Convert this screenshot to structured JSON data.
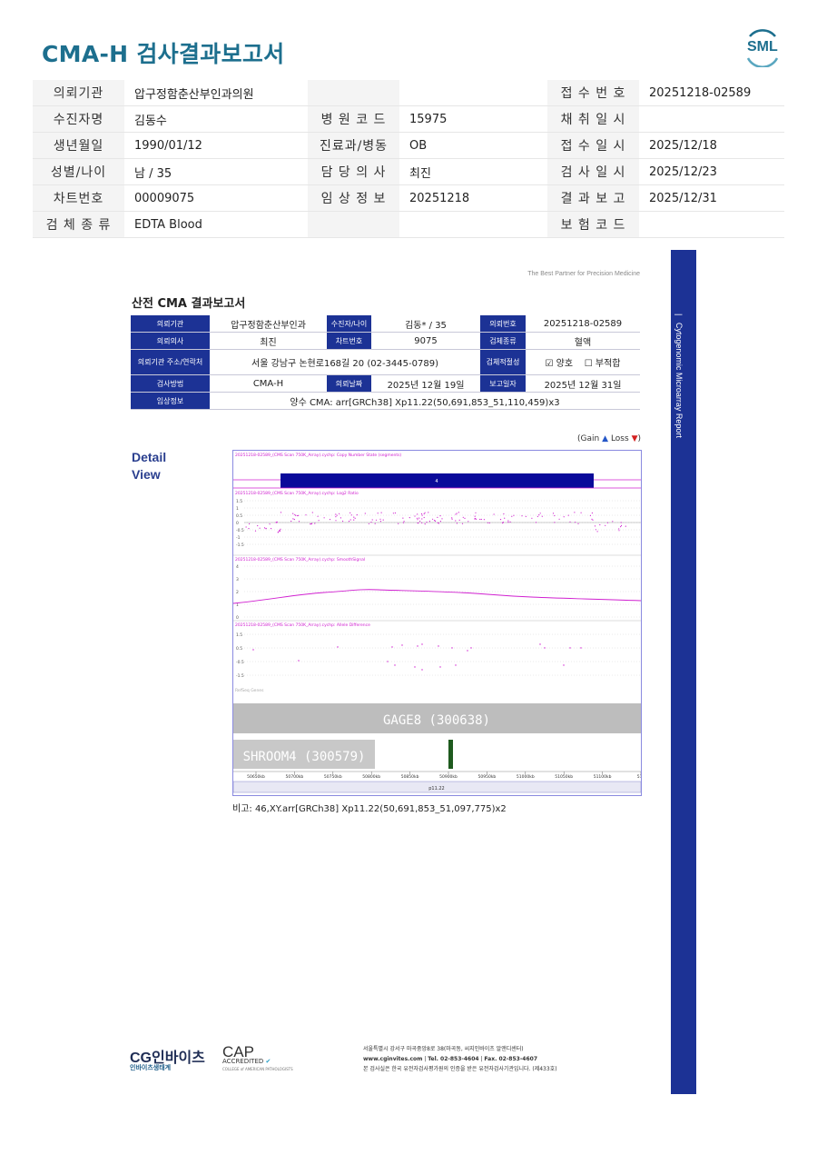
{
  "header": {
    "title": "CMA-H 검사결과보고서",
    "logo_text": "SML"
  },
  "info_rows": [
    {
      "l1": "의뢰기관",
      "v1": "압구정함춘산부인과의원",
      "l2": "",
      "v2": "",
      "l3": "접 수 번 호",
      "v3": "20251218-02589"
    },
    {
      "l1": "수진자명",
      "v1": "김동수",
      "l2": "병 원 코 드",
      "v2": "15975",
      "l3": "채 취 일 시",
      "v3": ""
    },
    {
      "l1": "생년월일",
      "v1": "1990/01/12",
      "l2": "진료과/병동",
      "v2": "OB",
      "l3": "접 수 일 시",
      "v3": "2025/12/18"
    },
    {
      "l1": "성별/나이",
      "v1": "남 / 35",
      "l2": "담 당 의 사",
      "v2": "최진",
      "l3": "검 사 일 시",
      "v3": "2025/12/23"
    },
    {
      "l1": "차트번호",
      "v1": "00009075",
      "l2": "임 상 정 보",
      "v2": "20251218",
      "l3": "결 과 보 고",
      "v3": "2025/12/31"
    },
    {
      "l1": "검 체 종 류",
      "v1": "EDTA Blood",
      "l2": "",
      "v2": "",
      "l3": "보 험 코 드",
      "v3": ""
    }
  ],
  "sidebar": {
    "text": "Cytogenomic Microarray Report"
  },
  "report": {
    "tagline": "The Best Partner for Precision Medicine",
    "title": "산전 CMA 결과보고서",
    "r1": {
      "a": "의뢰기관",
      "b": "압구정함춘산부인과",
      "c": "수진자/나이",
      "d": "김동* / 35",
      "e": "의뢰번호",
      "f": "20251218-02589"
    },
    "r2": {
      "a": "의뢰의사",
      "b": "최진",
      "c": "차트번호",
      "d": "9075",
      "e": "검체종류",
      "f": "혈액"
    },
    "r3": {
      "a": "의뢰기관 주소/연락처",
      "b": "서울 강남구 논현로168길 20 (02-3445-0789)",
      "e": "검체적절성",
      "f1": "☑ 양호",
      "f2": "☐ 부적합"
    },
    "r4": {
      "a": "검사방법",
      "b": "CMA-H",
      "c": "의뢰날짜",
      "d": "2025년 12월 19일",
      "e": "보고일자",
      "f": "2025년 12월 31일"
    },
    "r5": {
      "a": "임상정보",
      "b": "양수 CMA: arr[GRCh38] Xp11.22(50,691,853_51,110,459)x3"
    }
  },
  "detail": {
    "line1": "Detail",
    "line2": "View"
  },
  "gainloss": {
    "open": "(Gain",
    "up": "▲",
    "mid": "Loss",
    "dn": "▼",
    "close": ")"
  },
  "chart_data": {
    "type": "scatter",
    "title": "",
    "track_labels": [
      "20251218-02589_(CMS Scan 750K_Array).cychp: Copy Number State (segments)",
      "20251218-02589_(CMS Scan 750K_Array).cychp: Log2 Ratio",
      "20251218-02589_(CMS Scan 750K_Array).cychp: SmoothSignal",
      "20251218-02589_(CMS Scan 750K_Array).cychp: Allele Difference",
      "RefSeq Genes"
    ],
    "segment_label": "4",
    "gene_labels": [
      "GAGE8 (300638)",
      "SHROOM4 (300579)"
    ],
    "x_ticks": [
      "50650kb",
      "50700kb",
      "50750kb",
      "50800kb",
      "50850kb",
      "50900kb",
      "50950kb",
      "51000kb",
      "51050kb",
      "51100kb",
      "511"
    ],
    "band_label": "p11.22",
    "log2_ticks": [
      "1.5",
      "1",
      "0.5",
      "0",
      "-0.5",
      "-1",
      "-1.5"
    ],
    "smooth_ticks": [
      "4",
      "3",
      "2",
      "1",
      "0"
    ],
    "allele_ticks": [
      "1.5",
      "0.5",
      "-0.5",
      "-1.5"
    ],
    "ylabels": {
      "log2": "log2Ratio",
      "smooth": "",
      "allele": ""
    },
    "segment_color": "#0a0a9a",
    "point_color": "#d020d0"
  },
  "note": "비고: 46,XY.arr[GRCh38] Xp11.22(50,691,853_51,097,775)x2",
  "footer": {
    "cg_logo": "CG인바이츠",
    "cg_sub": "인바이츠생태계",
    "cap": "CAP",
    "cap_acc": "ACCREDITED",
    "cap_sub": "COLLEGE of AMERICAN PATHOLOGISTS",
    "addr1": "서울특별시 강서구 마곡중앙8로 38(마곡동, 씨지인바이츠 알앤디센터)",
    "addr2_a": "www.cginvites.com",
    "addr2_b": "Tel. 02-853-4604",
    "addr2_c": "Fax. 02-853-4607",
    "addr3": "본 검사실은 한국 유전자검사평가원의 인증을 받은 유전자검사기관입니다. (제433호)"
  }
}
